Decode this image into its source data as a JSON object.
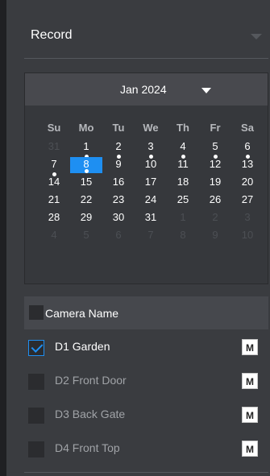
{
  "mode_select": {
    "value": "Record",
    "icon": "chevron-down-icon"
  },
  "calendar": {
    "month_label": "Jan 2024",
    "weekdays": [
      "Su",
      "Mo",
      "Tu",
      "We",
      "Th",
      "Fr",
      "Sa"
    ],
    "days": [
      {
        "label": "31",
        "other": true
      },
      {
        "label": "1",
        "dot": true
      },
      {
        "label": "2",
        "dot": true
      },
      {
        "label": "3",
        "dot": true
      },
      {
        "label": "4",
        "dot": true
      },
      {
        "label": "5",
        "dot": true
      },
      {
        "label": "6",
        "dot": true
      },
      {
        "label": "7",
        "dot": true
      },
      {
        "label": "8",
        "dot": true,
        "selected": true
      },
      {
        "label": "9"
      },
      {
        "label": "10"
      },
      {
        "label": "11"
      },
      {
        "label": "12"
      },
      {
        "label": "13"
      },
      {
        "label": "14"
      },
      {
        "label": "15"
      },
      {
        "label": "16"
      },
      {
        "label": "17"
      },
      {
        "label": "18"
      },
      {
        "label": "19"
      },
      {
        "label": "20"
      },
      {
        "label": "21"
      },
      {
        "label": "22"
      },
      {
        "label": "23"
      },
      {
        "label": "24"
      },
      {
        "label": "25"
      },
      {
        "label": "26"
      },
      {
        "label": "27"
      },
      {
        "label": "28"
      },
      {
        "label": "29"
      },
      {
        "label": "30"
      },
      {
        "label": "31"
      },
      {
        "label": "1",
        "other": true
      },
      {
        "label": "2",
        "other": true
      },
      {
        "label": "3",
        "other": true
      },
      {
        "label": "4",
        "other": true
      },
      {
        "label": "5",
        "other": true
      },
      {
        "label": "6",
        "other": true
      },
      {
        "label": "7",
        "other": true
      },
      {
        "label": "8",
        "other": true
      },
      {
        "label": "9",
        "other": true
      },
      {
        "label": "10",
        "other": true
      }
    ]
  },
  "camera_list": {
    "header_label": "Camera Name",
    "cameras": [
      {
        "name": "D1 Garden",
        "checked": true,
        "m_label": "M"
      },
      {
        "name": "D2 Front Door",
        "checked": false,
        "m_label": "M"
      },
      {
        "name": "D3 Back Gate",
        "checked": false,
        "m_label": "M"
      },
      {
        "name": "D4 Front Top",
        "checked": false,
        "m_label": "M"
      }
    ]
  },
  "colors": {
    "accent": "#1e8ff2",
    "panel_bg": "#3a3c40",
    "header_bg": "#46484d",
    "calendar_bg": "#36383c"
  }
}
